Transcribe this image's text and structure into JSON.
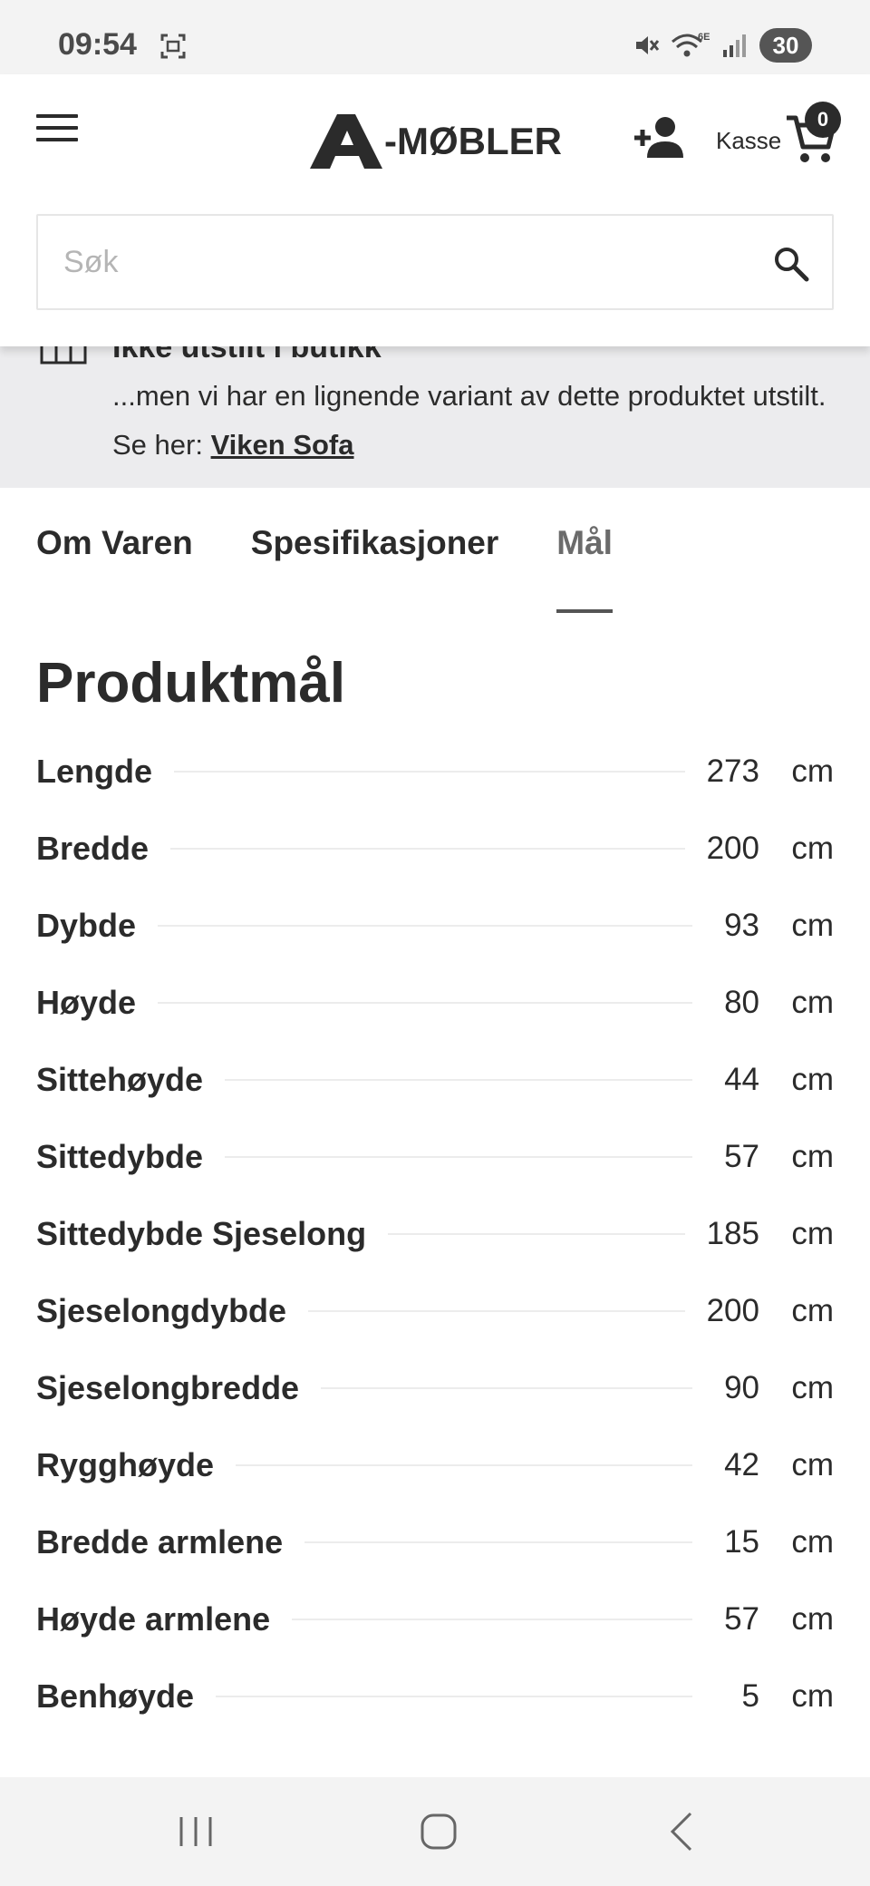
{
  "status_bar": {
    "time": "09:54",
    "battery": "30",
    "icons": [
      "screenshot-icon",
      "mute-icon",
      "wifi-6e-icon",
      "signal-icon"
    ]
  },
  "header": {
    "brand": "-MØBLER",
    "logo_mark": "A",
    "checkout_label": "Kasse",
    "cart_count": "0",
    "search_placeholder": "Søk"
  },
  "notice": {
    "title": "Ikke utstilt i butikk",
    "body": "...men vi har en lignende variant av dette produktet utstilt. Se her: ",
    "link_text": "Viken Sofa"
  },
  "tabs": [
    {
      "label": "Om Varen",
      "active": false
    },
    {
      "label": "Spesifikasjoner",
      "active": false
    },
    {
      "label": "Mål",
      "active": true
    }
  ],
  "dimensions": {
    "title": "Produktmål",
    "rows": [
      {
        "label": "Lengde",
        "value": "273",
        "unit": "cm"
      },
      {
        "label": "Bredde",
        "value": "200",
        "unit": "cm"
      },
      {
        "label": "Dybde",
        "value": "93",
        "unit": "cm"
      },
      {
        "label": "Høyde",
        "value": "80",
        "unit": "cm"
      },
      {
        "label": "Sittehøyde",
        "value": "44",
        "unit": "cm"
      },
      {
        "label": "Sittedybde",
        "value": "57",
        "unit": "cm"
      },
      {
        "label": "Sittedybde Sjeselong",
        "value": "185",
        "unit": "cm"
      },
      {
        "label": "Sjeselongdybde",
        "value": "200",
        "unit": "cm"
      },
      {
        "label": "Sjeselongbredde",
        "value": "90",
        "unit": "cm"
      },
      {
        "label": "Rygghøyde",
        "value": "42",
        "unit": "cm"
      },
      {
        "label": "Bredde armlene",
        "value": "15",
        "unit": "cm"
      },
      {
        "label": "Høyde armlene",
        "value": "57",
        "unit": "cm"
      },
      {
        "label": "Benhøyde",
        "value": "5",
        "unit": "cm"
      }
    ]
  },
  "nav_bar": {
    "icons": [
      "recent-apps-icon",
      "home-icon",
      "back-icon"
    ]
  }
}
